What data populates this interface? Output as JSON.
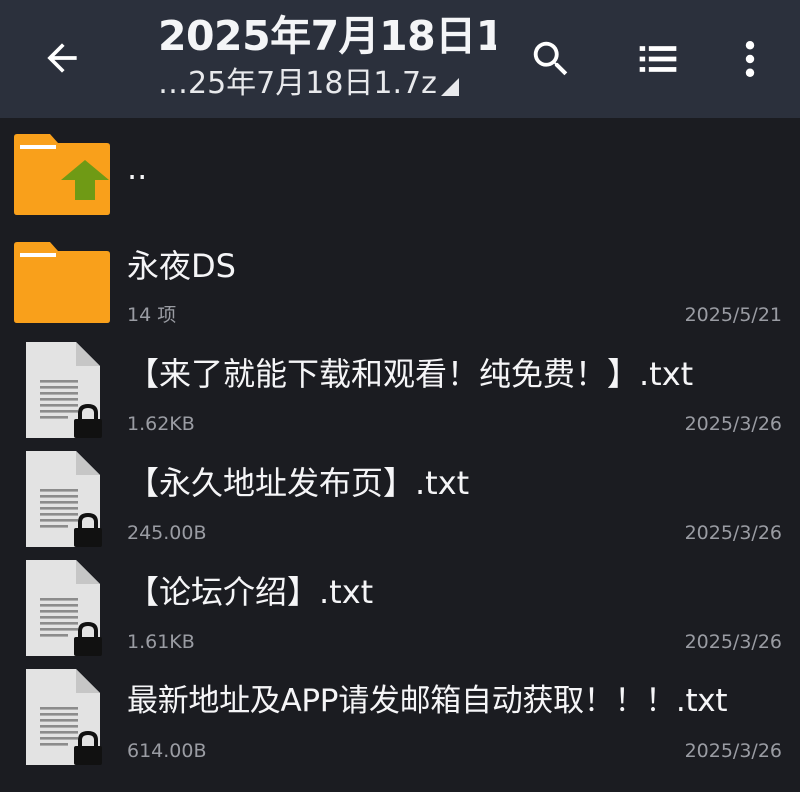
{
  "toolbar": {
    "title": "2025年7月18日1",
    "subtitle": "…25年7月18日1.7z"
  },
  "colors": {
    "toolbar_bg": "#2b303c",
    "list_bg": "#1b1c21",
    "folder_orange": "#f9a01b",
    "folder_up_arrow": "#6f9a15",
    "meta_text": "#9a9ca3"
  },
  "icons": {
    "back": "arrow-left-icon",
    "search": "search-icon",
    "view": "list-view-icon",
    "more": "more-vert-icon",
    "parent": "folder-up-icon",
    "folder": "folder-icon",
    "file": "text-file-locked-icon"
  },
  "parent_entry": {
    "label": ".."
  },
  "entries": [
    {
      "type": "folder",
      "name": "永夜DS",
      "meta": "14 项",
      "date": "2025/5/21"
    },
    {
      "type": "file",
      "name": "【来了就能下载和观看！纯免费！】.txt",
      "meta": "1.62KB",
      "date": "2025/3/26"
    },
    {
      "type": "file",
      "name": "【永久地址发布页】.txt",
      "meta": "245.00B",
      "date": "2025/3/26"
    },
    {
      "type": "file",
      "name": "【论坛介绍】.txt",
      "meta": "1.61KB",
      "date": "2025/3/26"
    },
    {
      "type": "file",
      "name": "最新地址及APP请发邮箱自动获取！！！.txt",
      "meta": "614.00B",
      "date": "2025/3/26"
    }
  ]
}
